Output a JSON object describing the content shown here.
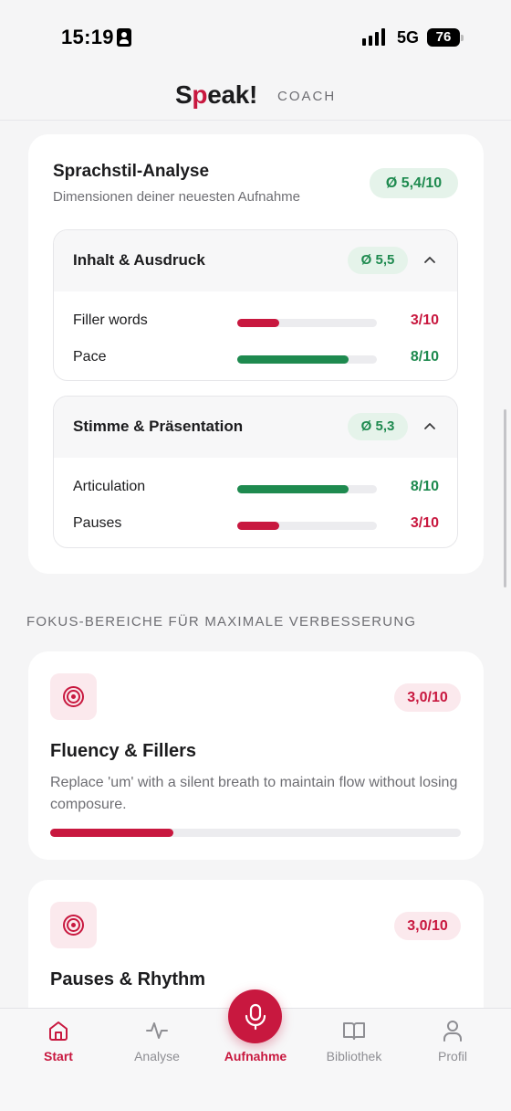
{
  "status_bar": {
    "time": "15:19",
    "network": "5G",
    "battery": "76"
  },
  "header": {
    "logo": "Speak!",
    "logo_prefix": "S",
    "logo_mark": "p",
    "logo_suffix": "eak!",
    "subtitle": "COACH"
  },
  "analysis": {
    "title": "Sprachstil-Analyse",
    "subtitle": "Dimensionen deiner neuesten Aufnahme",
    "average": "Ø 5,4/10",
    "groups": [
      {
        "title": "Inhalt & Ausdruck",
        "average": "Ø 5,5",
        "rows": [
          {
            "label": "Filler words",
            "score": "3/10",
            "value": 3,
            "status": "low"
          },
          {
            "label": "Pace",
            "score": "8/10",
            "value": 8,
            "status": "high"
          }
        ]
      },
      {
        "title": "Stimme & Präsentation",
        "average": "Ø 5,3",
        "rows": [
          {
            "label": "Articulation",
            "score": "8/10",
            "value": 8,
            "status": "high"
          },
          {
            "label": "Pauses",
            "score": "3/10",
            "value": 3,
            "status": "low"
          }
        ]
      }
    ]
  },
  "focus_section_title": "FOKUS-BEREICHE FÜR MAXIMALE VERBESSERUNG",
  "focus_cards": [
    {
      "icon": "target-icon",
      "score": "3,0/10",
      "value": 3.0,
      "title": "Fluency & Fillers",
      "description": "Replace 'um' with a silent breath to maintain flow without losing composure."
    },
    {
      "icon": "target-icon",
      "score": "3,0/10",
      "value": 3.0,
      "title": "Pauses & Rhythm",
      "description": ""
    }
  ],
  "nav": [
    {
      "label": "Start",
      "icon": "home-icon",
      "active": true
    },
    {
      "label": "Analyse",
      "icon": "activity-icon",
      "active": false
    },
    {
      "label": "Aufnahme",
      "icon": "mic-icon",
      "active": true
    },
    {
      "label": "Bibliothek",
      "icon": "book-icon",
      "active": false
    },
    {
      "label": "Profil",
      "icon": "person-icon",
      "active": false
    }
  ],
  "colors": {
    "accent": "#c8183f",
    "good": "#1e8a4f",
    "good_bg": "#e5f3ea",
    "accent_bg": "#fbe9ed"
  }
}
